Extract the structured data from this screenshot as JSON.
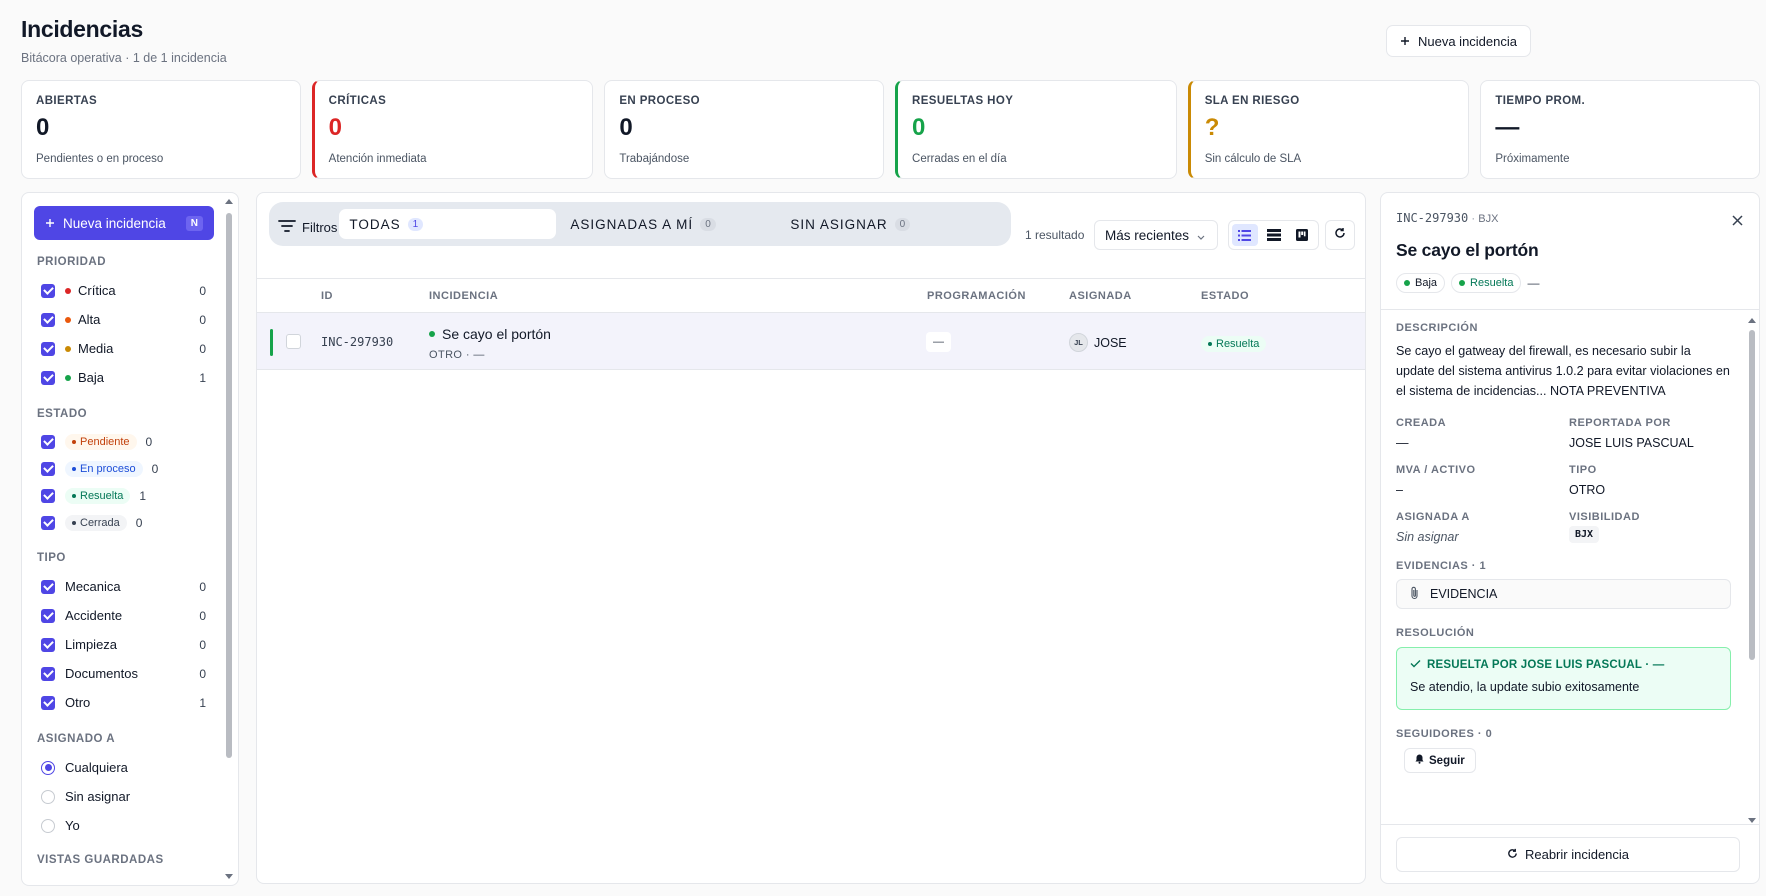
{
  "header": {
    "title": "Incidencias",
    "subtitle": "Bitácora operativa · 1 de 1 incidencia",
    "new_button": "Nueva incidencia"
  },
  "stats": [
    {
      "label": "ABIERTAS",
      "value": "0",
      "hint": "Pendientes o en proceso",
      "color": "#111827"
    },
    {
      "label": "CRÍTICAS",
      "value": "0",
      "hint": "Atención inmediata",
      "color": "#dc2626"
    },
    {
      "label": "EN PROCESO",
      "value": "0",
      "hint": "Trabajándose",
      "color": "#111827"
    },
    {
      "label": "RESUELTAS HOY",
      "value": "0",
      "hint": "Cerradas en el día",
      "color": "#16a34a"
    },
    {
      "label": "SLA EN RIESGO",
      "value": "?",
      "hint": "Sin cálculo de SLA",
      "color": "#ca8a04"
    },
    {
      "label": "TIEMPO PROM.",
      "value": "—",
      "hint": "Próximamente",
      "color": "#111827"
    }
  ],
  "sidebar": {
    "new_button": "Nueva incidencia",
    "shortcut": "N",
    "prioridad": {
      "title": "PRIORIDAD",
      "items": [
        {
          "label": "Crítica",
          "count": "0",
          "color": "#dc2626"
        },
        {
          "label": "Alta",
          "count": "0",
          "color": "#ea580c"
        },
        {
          "label": "Media",
          "count": "0",
          "color": "#ca8a04"
        },
        {
          "label": "Baja",
          "count": "1",
          "color": "#16a34a"
        }
      ]
    },
    "estado": {
      "title": "ESTADO",
      "items": [
        {
          "label": "Pendiente",
          "count": "0",
          "fg": "#c2410c",
          "bg": "#fff7ed"
        },
        {
          "label": "En proceso",
          "count": "0",
          "fg": "#1d4ed8",
          "bg": "#eff6ff"
        },
        {
          "label": "Resuelta",
          "count": "1",
          "fg": "#047857",
          "bg": "#ecfdf5"
        },
        {
          "label": "Cerrada",
          "count": "0",
          "fg": "#374151",
          "bg": "#f3f4f6"
        }
      ]
    },
    "tipo": {
      "title": "TIPO",
      "items": [
        {
          "label": "Mecanica",
          "count": "0"
        },
        {
          "label": "Accidente",
          "count": "0"
        },
        {
          "label": "Limpieza",
          "count": "0"
        },
        {
          "label": "Documentos",
          "count": "0"
        },
        {
          "label": "Otro",
          "count": "1"
        }
      ]
    },
    "asignado": {
      "title": "ASIGNADO A",
      "options": [
        "Cualquiera",
        "Sin asignar",
        "Yo"
      ],
      "selected": "Cualquiera"
    },
    "vistas_title": "VISTAS GUARDADAS"
  },
  "toolbar": {
    "filters_label": "Filtros",
    "tabs": [
      {
        "label": "TODAS",
        "count": "1"
      },
      {
        "label": "ASIGNADAS A MÍ",
        "count": "0"
      },
      {
        "label": "SIN ASIGNAR",
        "count": "0"
      }
    ],
    "results": "1 resultado",
    "sort": "Más recientes"
  },
  "table": {
    "columns": {
      "id": "ID",
      "incidencia": "INCIDENCIA",
      "programacion": "PROGRAMACIÓN",
      "asignada": "ASIGNADA",
      "estado": "ESTADO"
    },
    "rows": [
      {
        "id": "INC-297930",
        "title": "Se cayo el portón",
        "meta": "OTRO · —",
        "programacion": "—",
        "initials": "JL",
        "asignada": "JOSE",
        "estado": "Resuelta"
      }
    ]
  },
  "detail": {
    "code": "INC-297930",
    "site": "BJX",
    "title": "Se cayo el portón",
    "priority_tag": "Baja",
    "state_tag": "Resuelta",
    "dash": "—",
    "descripcion_label": "DESCRIPCIÓN",
    "descripcion": "Se cayo el gatweay del firewall, es necesario subir la update del sistema antivirus 1.0.2 para evitar violaciones en el sistema de incidencias... NOTA PREVENTIVA",
    "creada_label": "CREADA",
    "creada": "—",
    "reportada_label": "REPORTADA POR",
    "reportada": "JOSE LUIS PASCUAL",
    "mva_label": "MVA / ACTIVO",
    "mva": "–",
    "tipo_label": "TIPO",
    "tipo": "OTRO",
    "asignada_label": "ASIGNADA A",
    "asignada": "Sin asignar",
    "visibilidad_label": "VISIBILIDAD",
    "visibilidad": "BJX",
    "evidencias_label": "EVIDENCIAS · 1",
    "evidencia": "EVIDENCIA",
    "resolucion_label": "RESOLUCIÓN",
    "resolucion_title": "RESUELTA POR JOSE LUIS PASCUAL · —",
    "resolucion_text": "Se atendio, la update subio exitosamente",
    "seguidores_label": "SEGUIDORES · 0",
    "seguir": "Seguir",
    "reopen": "Reabrir incidencia"
  }
}
